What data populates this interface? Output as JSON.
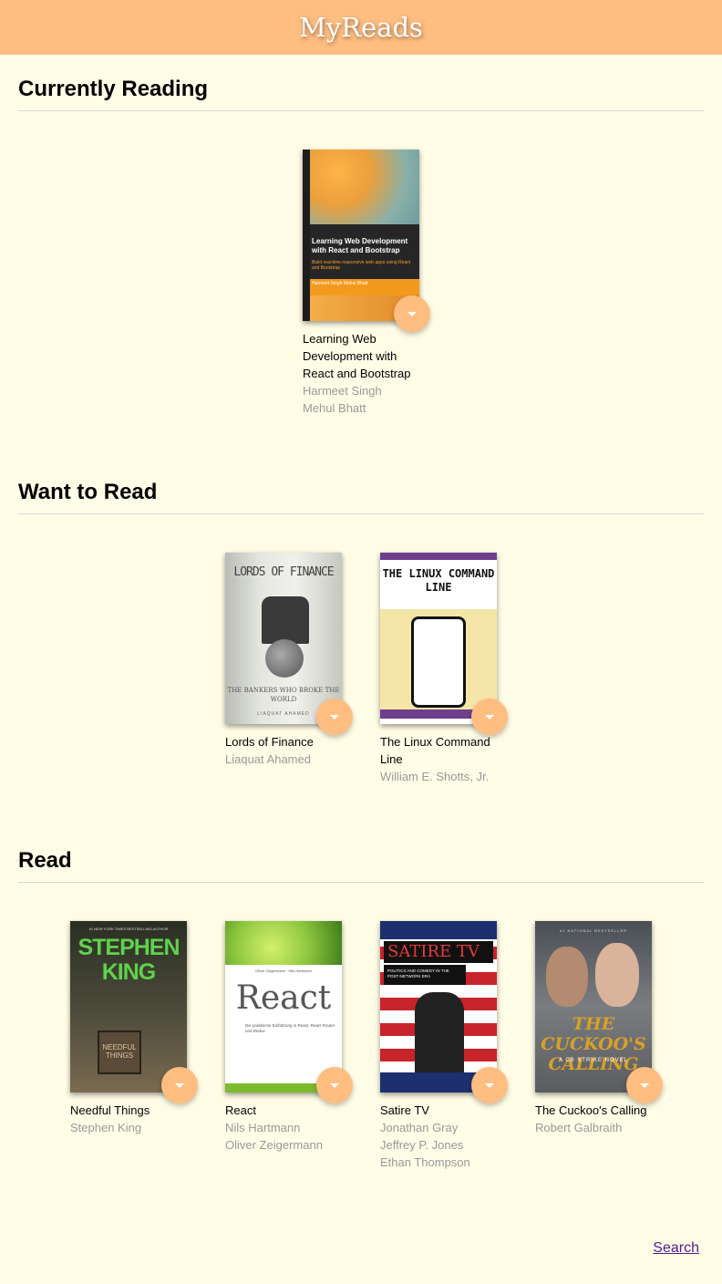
{
  "header": {
    "title": "MyReads"
  },
  "shelves": [
    {
      "title": "Currently Reading",
      "books": [
        {
          "title": "Learning Web Development with React and Bootstrap",
          "authors": [
            "Harmeet Singh",
            "Mehul Bhatt"
          ]
        }
      ]
    },
    {
      "title": "Want to Read",
      "books": [
        {
          "title": "Lords of Finance",
          "authors": [
            "Liaquat Ahamed"
          ]
        },
        {
          "title": "The Linux Command Line",
          "authors": [
            "William E. Shotts, Jr."
          ]
        }
      ]
    },
    {
      "title": "Read",
      "books": [
        {
          "title": "Needful Things",
          "authors": [
            "Stephen King"
          ]
        },
        {
          "title": "React",
          "authors": [
            "Nils Hartmann",
            "Oliver Zeigermann"
          ]
        },
        {
          "title": "Satire TV",
          "authors": [
            "Jonathan Gray",
            "Jeffrey P. Jones",
            "Ethan Thompson"
          ]
        },
        {
          "title": "The Cuckoo's Calling",
          "authors": [
            "Robert Galbraith"
          ]
        }
      ]
    }
  ],
  "covers": {
    "c1": {
      "title": "Learning Web Development with React and Bootstrap",
      "subtitle": "Build real-time responsive web apps using React and Bootstrap",
      "authors": "Harmeet Singh Mehul Bhatt"
    },
    "c2": {
      "title": "LORDS OF FINANCE",
      "subtitle": "THE BANKERS WHO BROKE THE WORLD",
      "author": "LIAQUAT AHAMED"
    },
    "c3": {
      "title": "THE LINUX COMMAND LINE"
    },
    "c4": {
      "tag": "#1 NEW YORK TIMES BESTSELLING AUTHOR",
      "title": "STEPHEN KING",
      "sign": "NEEDFUL THINGS"
    },
    "c5": {
      "mini": "Oliver Zeigermann · Nils Hartmann",
      "title": "React",
      "subtitle": "Die praktische Einführung in React, React Router und Redux"
    },
    "c6": {
      "title": "SATIRE",
      "title_accent": "TV",
      "subtitle": "POLITICS AND COMEDY IN THE POST-NETWORK ERA"
    },
    "c7": {
      "tag": "#1 NATIONAL BESTSELLER",
      "title": "THE CUCKOO'S CALLING",
      "subtitle": "A CB STRIKE NOVEL"
    }
  },
  "footer": {
    "search_label": "Search"
  },
  "colors": {
    "accent": "#ffbd80",
    "background": "#fffde6",
    "author_gray": "#999999"
  },
  "icons": {
    "shelf_changer": "chevron-down-icon"
  }
}
